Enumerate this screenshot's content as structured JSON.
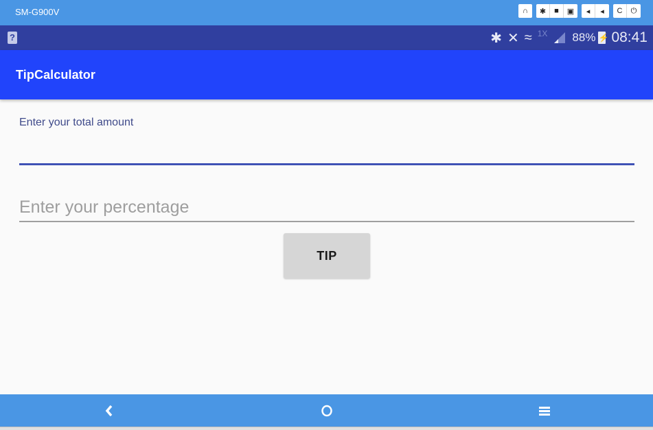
{
  "emulator": {
    "device_name": "SM-G900V",
    "tools": [
      {
        "icon": "headset-icon",
        "glyph": "∩"
      },
      {
        "icon": "settings-icon",
        "glyph": "✱"
      },
      {
        "icon": "video-icon",
        "glyph": "■"
      },
      {
        "icon": "camera-icon",
        "glyph": "▣"
      },
      {
        "icon": "volume-down-icon",
        "glyph": "◂"
      },
      {
        "icon": "volume-up-icon",
        "glyph": "◂"
      },
      {
        "icon": "rotate-icon",
        "glyph": "C"
      },
      {
        "icon": "power-icon",
        "glyph": "⏻"
      }
    ]
  },
  "status_bar": {
    "sim_icon_glyph": "?",
    "bluetooth_glyph": "✱",
    "mute_glyph": "✕",
    "wifi_glyph": "≈",
    "network_type": "1X",
    "battery_percent": "88%",
    "battery_glyph": "⚡",
    "time": "08:41"
  },
  "app_bar": {
    "title": "TipCalculator"
  },
  "form": {
    "total_label": "Enter your total amount",
    "total_value": "",
    "percentage_placeholder": "Enter your percentage",
    "percentage_value": "",
    "tip_button_label": "TIP"
  },
  "nav_bar": {
    "back_glyph": "❮",
    "home_glyph": "○",
    "menu_glyph": "≡"
  },
  "colors": {
    "app_bar": "#2144fb",
    "status_bar": "#303f9f",
    "emulator_chrome": "#4a96e4",
    "accent": "#3f51b5"
  }
}
